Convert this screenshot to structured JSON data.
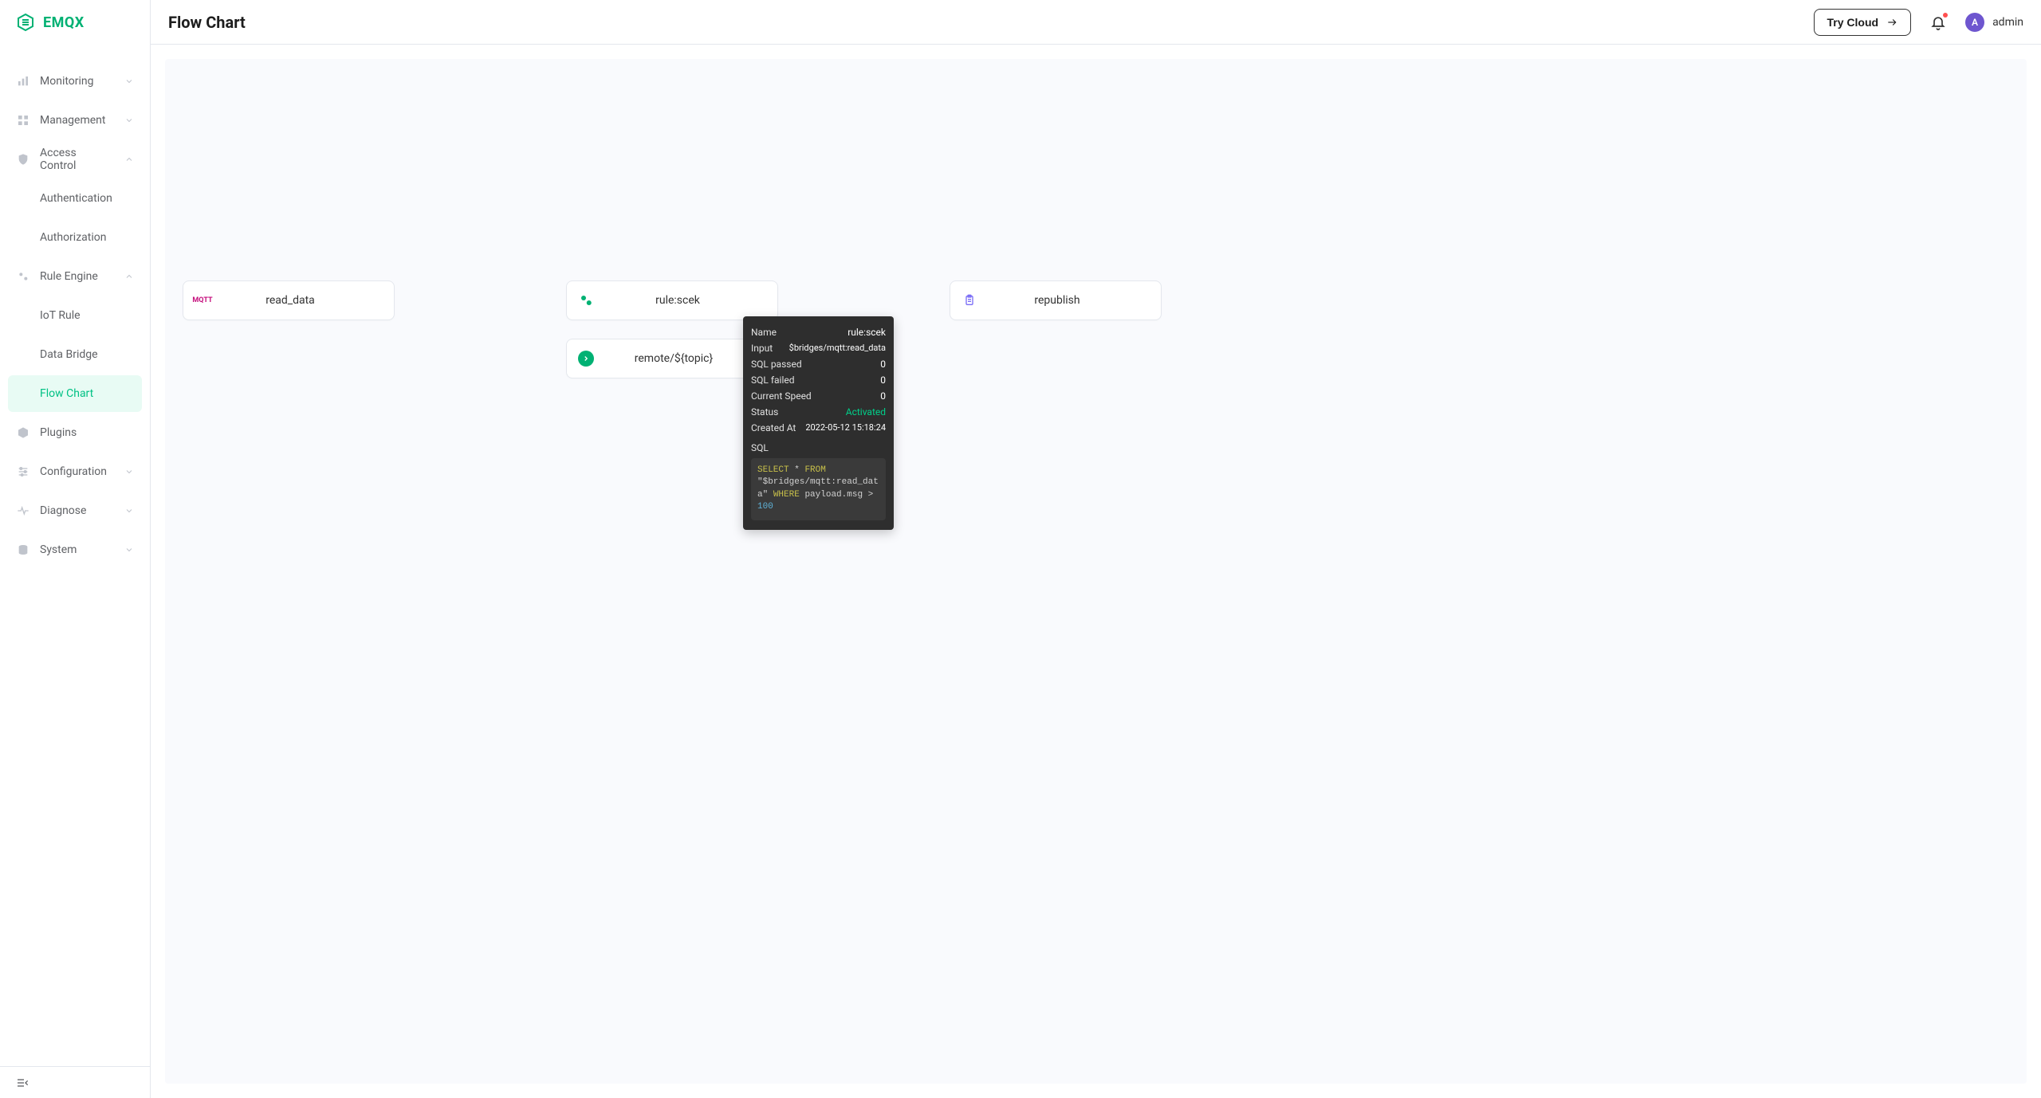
{
  "brand": "EMQX",
  "page_title": "Flow Chart",
  "header": {
    "try_cloud": "Try Cloud",
    "user_initial": "A",
    "user_name": "admin"
  },
  "sidebar": {
    "items": [
      {
        "kind": "group",
        "label": "Monitoring",
        "icon": "chart-bar",
        "expanded": false
      },
      {
        "kind": "group",
        "label": "Management",
        "icon": "grid",
        "expanded": false
      },
      {
        "kind": "group",
        "label": "Access Control",
        "icon": "shield",
        "expanded": true
      },
      {
        "kind": "child",
        "label": "Authentication"
      },
      {
        "kind": "child",
        "label": "Authorization"
      },
      {
        "kind": "group",
        "label": "Rule Engine",
        "icon": "gears",
        "expanded": true
      },
      {
        "kind": "child",
        "label": "IoT Rule"
      },
      {
        "kind": "child",
        "label": "Data Bridge"
      },
      {
        "kind": "child",
        "label": "Flow Chart",
        "active": true
      },
      {
        "kind": "group",
        "label": "Plugins",
        "icon": "cube",
        "expanded": false,
        "hide_chevron": true
      },
      {
        "kind": "group",
        "label": "Configuration",
        "icon": "sliders",
        "expanded": false
      },
      {
        "kind": "group",
        "label": "Diagnose",
        "icon": "pulse",
        "expanded": false
      },
      {
        "kind": "group",
        "label": "System",
        "icon": "stack",
        "expanded": false
      }
    ]
  },
  "flow": {
    "nodes": {
      "read_data": {
        "label": "read_data"
      },
      "rule": {
        "label": "rule:scek"
      },
      "topic": {
        "label": "remote/${topic}"
      },
      "republish": {
        "label": "republish"
      }
    },
    "popover": {
      "name_label": "Name",
      "name": "rule:scek",
      "input_label": "Input",
      "input": "$bridges/mqtt:read_data",
      "sql_passed_label": "SQL passed",
      "sql_passed": "0",
      "sql_failed_label": "SQL failed",
      "sql_failed": "0",
      "speed_label": "Current Speed",
      "speed": "0",
      "status_label": "Status",
      "status": "Activated",
      "created_label": "Created At",
      "created": "2022-05-12 15:18:24",
      "sql_label": "SQL",
      "sql_select": "SELECT",
      "sql_star": "*",
      "sql_from": "FROM",
      "sql_src": "\"$bridges/mqtt:read_data\"",
      "sql_where": "WHERE",
      "sql_expr": "payload.msg >",
      "sql_num": "100"
    }
  }
}
